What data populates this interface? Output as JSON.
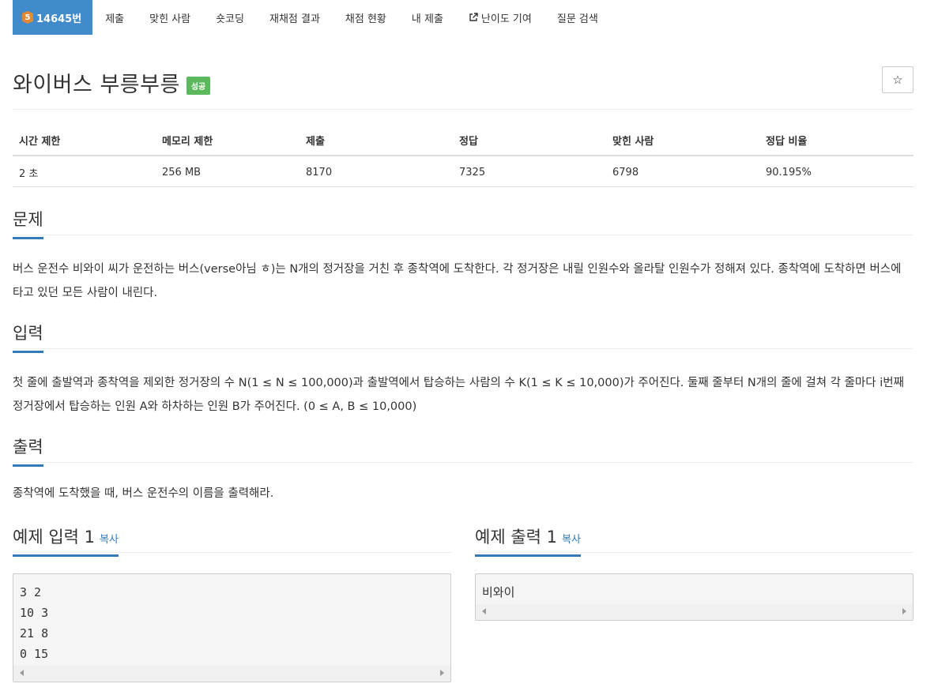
{
  "nav": {
    "problem": {
      "tier": "5",
      "label": "14645번"
    },
    "items": [
      "제출",
      "맞힌 사람",
      "숏코딩",
      "재채점 결과",
      "채점 현황",
      "내 제출",
      "난이도 기여",
      "질문 검색"
    ]
  },
  "problem": {
    "title": "와이버스 부릉부릉",
    "status_badge": "성공",
    "star": "☆"
  },
  "info": {
    "headers": [
      "시간 제한",
      "메모리 제한",
      "제출",
      "정답",
      "맞힌 사람",
      "정답 비율"
    ],
    "values": [
      "2 초",
      "256 MB",
      "8170",
      "7325",
      "6798",
      "90.195%"
    ]
  },
  "sections": {
    "description": {
      "title": "문제",
      "text": "버스 운전수 비와이 씨가 운전하는 버스(verse아님 ㅎ)는 N개의 정거장을 거친 후 종착역에 도착한다. 각 정거장은 내릴 인원수와 올라탈 인원수가 정해져 있다. 종착역에 도착하면 버스에 타고 있던 모든 사람이 내린다."
    },
    "input": {
      "title": "입력",
      "text": "첫 줄에 출발역과 종착역을 제외한 정거장의 수 N(1 ≤ N ≤ 100,000)과 출발역에서 탑승하는 사람의 수 K(1 ≤ K ≤ 10,000)가 주어진다. 둘째 줄부터 N개의 줄에 걸쳐 각 줄마다 i번째 정거장에서 탑승하는 인원 A와 하차하는 인원 B가 주어진다. (0 ≤ A, B ≤ 10,000)"
    },
    "output": {
      "title": "출력",
      "text": "종착역에 도착했을 때, 버스 운전수의 이름을 출력해라."
    }
  },
  "samples": {
    "input": {
      "title": "예제 입력 1",
      "copy": "복사",
      "content": "3 2\n10 3\n21 8\n0 15"
    },
    "output": {
      "title": "예제 출력 1",
      "copy": "복사",
      "content": "비와이"
    }
  },
  "colors": {
    "primary": "#428bca",
    "success": "#5cb85c",
    "tier_bronze": "#e08a35"
  }
}
